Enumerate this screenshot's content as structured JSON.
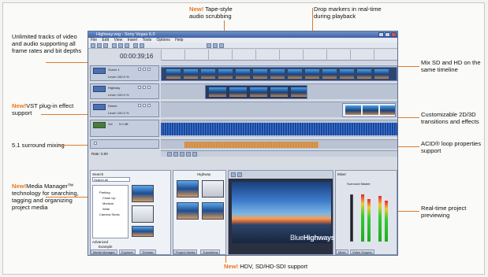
{
  "callouts": {
    "unlimited_tracks": "Unlimited tracks of video and audio supporting all frame rates and bit depths",
    "new_badge": "New!",
    "vst_plugin": "VST plug-in effect support",
    "surround": "5.1 surround mixing",
    "media_manager": "Media Manager™ technology for searching, tagging and organizing project media",
    "tape_scrub": "Tape-style audio scrubbing",
    "drop_markers": "Drop markers in real-time during playback",
    "mix_sd_hd": "Mix SD and HD on the same timeline",
    "transitions": "Customizable 2D/3D transitions and effects",
    "acid_loop": "ACID® loop properties support",
    "realtime_preview": "Real-time project previewing",
    "hdv_support": "HDV, SD/HD-SDI support"
  },
  "app": {
    "title": "Highway.veg - Sony Vegas 6.0",
    "menu": [
      "File",
      "Edit",
      "View",
      "Insert",
      "Tools",
      "Options",
      "Help"
    ],
    "timecode": "00:00:39;16",
    "tracks": [
      {
        "name": "Scene 1",
        "level": "Level: 100.0 %"
      },
      {
        "name": "Highway",
        "level": "Level: 100.0 %"
      },
      {
        "name": "Dinner",
        "level": "Level: 100.0 %"
      }
    ],
    "audio_track": {
      "name": "Vol",
      "value": "0.0 dB"
    },
    "rate": "Rate: 0.00",
    "panels": {
      "media_tabs": [
        "Media Manager",
        "Explorer",
        "Trimmer",
        "Project Media",
        "Transitions"
      ],
      "search_label": "Search",
      "search_value": "Search all",
      "advanced": "Advanced",
      "example": "Example",
      "preview_label": "Highway",
      "preview_tree": [
        "Parking",
        "Close Up",
        "Medium",
        "Wide",
        "Camera Shots"
      ],
      "mixer_label": "Mixer",
      "mixer_tabs": [
        "Mixer",
        "Video Scopes"
      ],
      "brand_a": "Blue",
      "brand_b": "Highways",
      "record_time": "Record Time: 67:41:45",
      "complete": "Complete: 00:00:00",
      "surround_master": "Surround Master"
    }
  }
}
